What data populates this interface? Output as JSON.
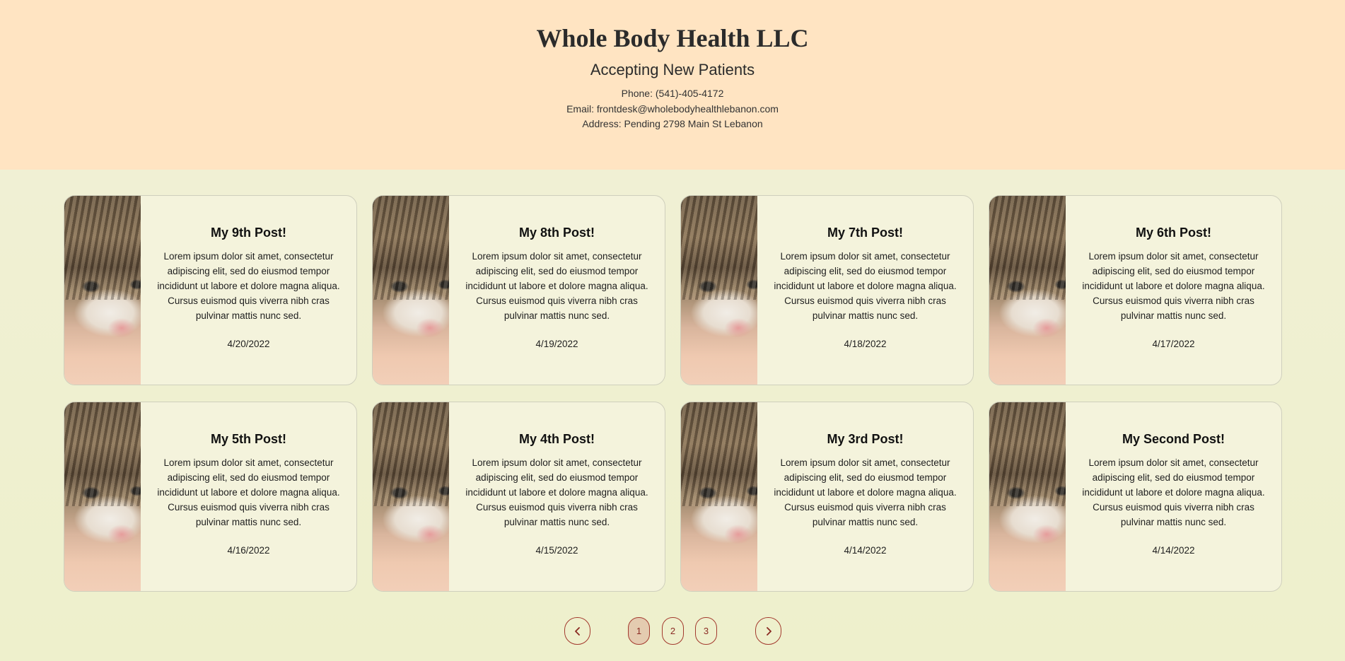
{
  "header": {
    "title": "Whole Body Health LLC",
    "subtitle": "Accepting New Patients",
    "phone": "Phone: (541)-405-4172",
    "email": "Email: frontdesk@wholebodyhealthlebanon.com",
    "address": "Address: Pending 2798 Main St Lebanon"
  },
  "posts": [
    {
      "title": "My 9th Post!",
      "text": "Lorem ipsum dolor sit amet, consectetur adipiscing elit, sed do eiusmod tempor incididunt ut labore et dolore magna aliqua. Cursus euismod quis viverra nibh cras pulvinar mattis nunc sed.",
      "date": "4/20/2022"
    },
    {
      "title": "My 8th Post!",
      "text": "Lorem ipsum dolor sit amet, consectetur adipiscing elit, sed do eiusmod tempor incididunt ut labore et dolore magna aliqua. Cursus euismod quis viverra nibh cras pulvinar mattis nunc sed.",
      "date": "4/19/2022"
    },
    {
      "title": "My 7th Post!",
      "text": "Lorem ipsum dolor sit amet, consectetur adipiscing elit, sed do eiusmod tempor incididunt ut labore et dolore magna aliqua. Cursus euismod quis viverra nibh cras pulvinar mattis nunc sed.",
      "date": "4/18/2022"
    },
    {
      "title": "My 6th Post!",
      "text": "Lorem ipsum dolor sit amet, consectetur adipiscing elit, sed do eiusmod tempor incididunt ut labore et dolore magna aliqua. Cursus euismod quis viverra nibh cras pulvinar mattis nunc sed.",
      "date": "4/17/2022"
    },
    {
      "title": "My 5th Post!",
      "text": "Lorem ipsum dolor sit amet, consectetur adipiscing elit, sed do eiusmod tempor incididunt ut labore et dolore magna aliqua. Cursus euismod quis viverra nibh cras pulvinar mattis nunc sed.",
      "date": "4/16/2022"
    },
    {
      "title": "My 4th Post!",
      "text": "Lorem ipsum dolor sit amet, consectetur adipiscing elit, sed do eiusmod tempor incididunt ut labore et dolore magna aliqua. Cursus euismod quis viverra nibh cras pulvinar mattis nunc sed.",
      "date": "4/15/2022"
    },
    {
      "title": "My 3rd Post!",
      "text": "Lorem ipsum dolor sit amet, consectetur adipiscing elit, sed do eiusmod tempor incididunt ut labore et dolore magna aliqua. Cursus euismod quis viverra nibh cras pulvinar mattis nunc sed.",
      "date": "4/14/2022"
    },
    {
      "title": "My Second Post!",
      "text": "Lorem ipsum dolor sit amet, consectetur adipiscing elit, sed do eiusmod tempor incididunt ut labore et dolore magna aliqua. Cursus euismod quis viverra nibh cras pulvinar mattis nunc sed.",
      "date": "4/14/2022"
    }
  ],
  "pagination": {
    "prev_icon": "chevron-left-icon",
    "next_icon": "chevron-right-icon",
    "prev_glyph": "‹",
    "next_glyph": "›",
    "pages": [
      "1",
      "2",
      "3"
    ],
    "current_page": "1"
  },
  "colors": {
    "header_bg": "#ffe4c2",
    "page_bg": "#efefcf",
    "card_bg": "#f4f3dc",
    "pager_accent": "#a33a2e",
    "pager_active_bg": "#e4cbb0"
  }
}
